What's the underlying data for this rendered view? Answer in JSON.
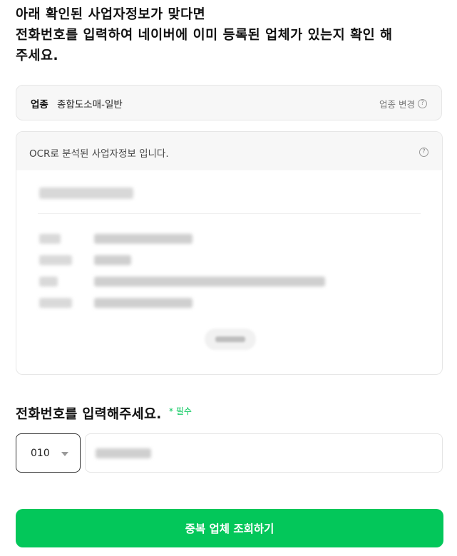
{
  "heading": {
    "line1": "아래 확인된 사업자정보가 맞다면",
    "line2": "전화번호를 입력하여 네이버에 이미 등록된 업체가 있는지 확인 해",
    "line3": "주세요."
  },
  "industry": {
    "label": "업종",
    "value": "종합도소매-일반",
    "change_label": "업종 변경",
    "help_icon": "question-circle-icon"
  },
  "ocr": {
    "title": "OCR로 분석된 사업자정보 입니다.",
    "help_icon": "question-circle-icon"
  },
  "phone": {
    "title": "전화번호를 입력해주세요.",
    "required_mark": "*",
    "required_label": "필수",
    "prefix": "010",
    "prefix_icon": "caret-down-icon"
  },
  "submit_label": "중복 업체 조회하기",
  "colors": {
    "accent": "#03c75a",
    "box_background": "#f7f7f7"
  }
}
